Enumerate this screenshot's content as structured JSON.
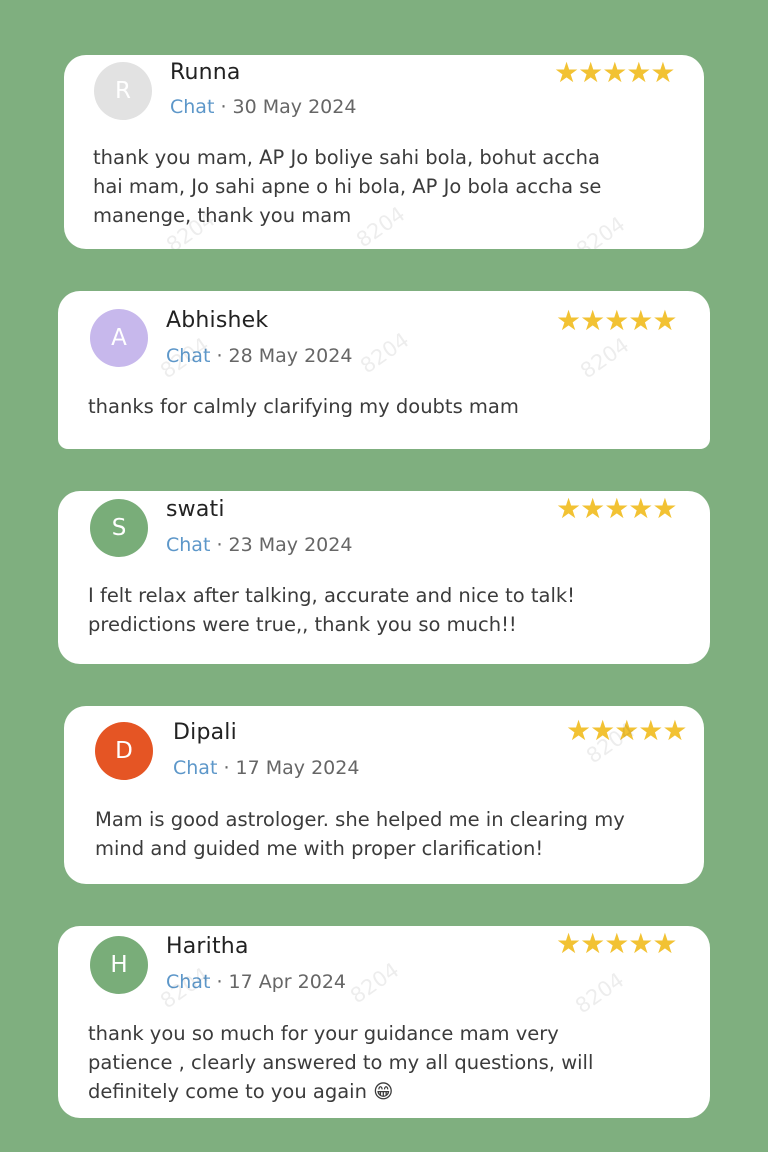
{
  "reviews": [
    {
      "initial": "R",
      "name": "Runna",
      "channel": "Chat",
      "separator": " · ",
      "date": "30 May 2024",
      "rating": 5,
      "stars": "★★★★★",
      "text": "thank you mam, AP Jo boliye sahi bola, bohut accha\nhai mam, Jo sahi apne o hi bola, AP Jo bola accha se\nmanenge, thank you mam",
      "avatar_color": "#e2e2e2"
    },
    {
      "initial": "A",
      "name": "Abhishek",
      "channel": "Chat",
      "separator": " · ",
      "date": "28 May 2024",
      "rating": 5,
      "stars": "★★★★★",
      "text": "thanks for calmly clarifying my doubts mam",
      "avatar_color": "#c7b8ec"
    },
    {
      "initial": "S",
      "name": "swati",
      "channel": "Chat",
      "separator": " · ",
      "date": "23 May 2024",
      "rating": 5,
      "stars": "★★★★★",
      "text": "I felt relax after talking, accurate and nice to talk!\npredictions were true,, thank you so much!!",
      "avatar_color": "#79ad79"
    },
    {
      "initial": "D",
      "name": "Dipali",
      "channel": "Chat",
      "separator": " · ",
      "date": "17 May 2024",
      "rating": 5,
      "stars": "★★★★★",
      "text": "Mam is good astrologer. she helped me in clearing my\nmind and guided me with proper clarification!",
      "avatar_color": "#e55524"
    },
    {
      "initial": "H",
      "name": "Haritha",
      "channel": "Chat",
      "separator": " · ",
      "date": "17 Apr 2024",
      "rating": 5,
      "stars": "★★★★★",
      "text": "thank you so much for your guidance mam very\npatience , clearly answered to my all questions, will\ndefinitely come to you again 😁",
      "avatar_color": "#79ad79"
    }
  ],
  "watermark": "8204"
}
